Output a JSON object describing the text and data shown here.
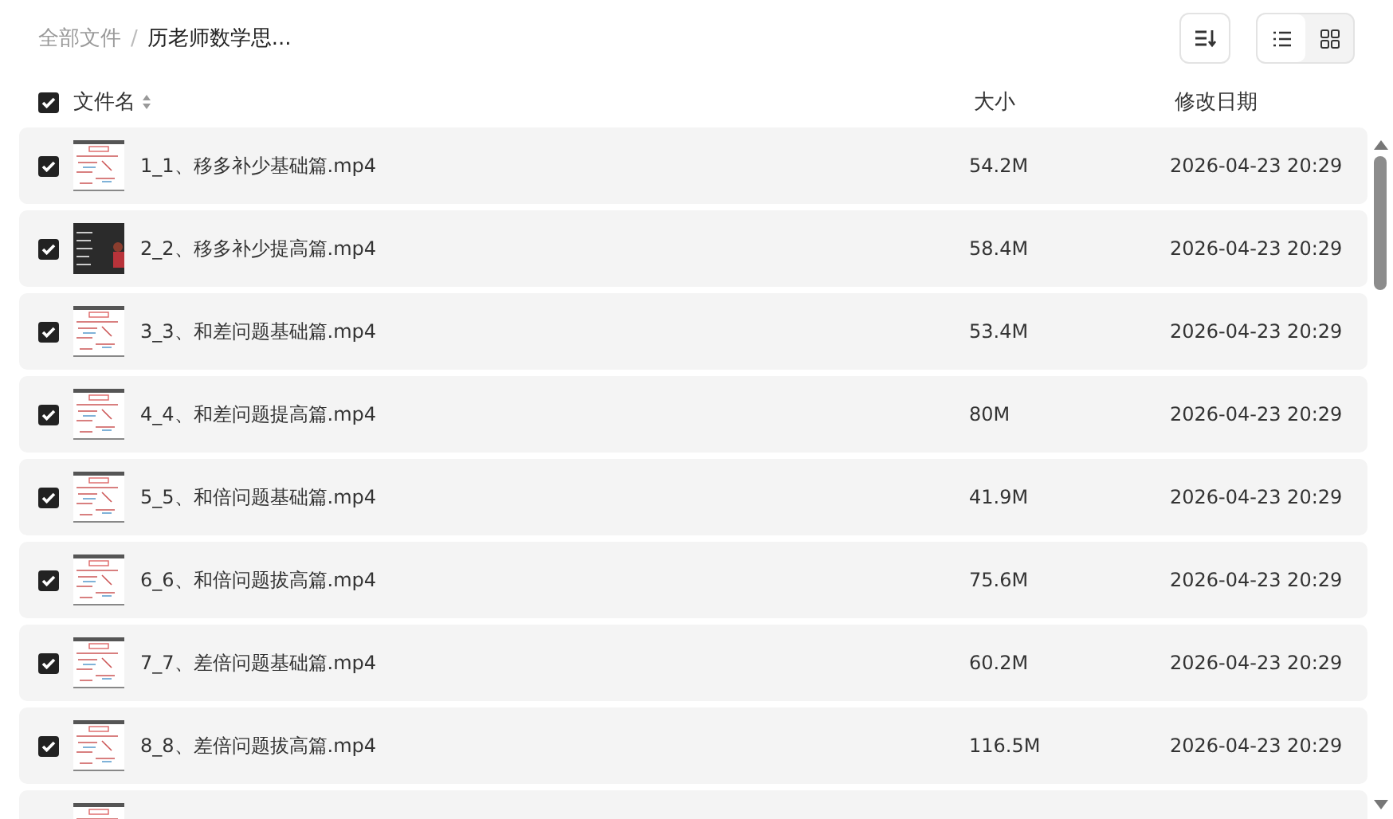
{
  "breadcrumb": [
    {
      "label": "全部文件",
      "current": false
    },
    {
      "label": "历老师数学思...",
      "current": true
    }
  ],
  "breadcrumb_separator": "/",
  "view_modes": [
    {
      "kind": "list",
      "selected": true
    },
    {
      "kind": "grid",
      "selected": false
    }
  ],
  "header": {
    "checked": true,
    "columns": [
      "文件名",
      "大小",
      "修改日期"
    ]
  },
  "rows": [
    {
      "checked": true,
      "kind": "document",
      "name": "1_1、移多补少基础篇.mp4",
      "size": "54.2M",
      "date": "2026-04-23 20:29"
    },
    {
      "checked": true,
      "kind": "dark",
      "name": "2_2、移多补少提高篇.mp4",
      "size": "58.4M",
      "date": "2026-04-23 20:29"
    },
    {
      "checked": true,
      "kind": "document",
      "name": "3_3、和差问题基础篇.mp4",
      "size": "53.4M",
      "date": "2026-04-23 20:29"
    },
    {
      "checked": true,
      "kind": "document",
      "name": "4_4、和差问题提高篇.mp4",
      "size": "80M",
      "date": "2026-04-23 20:29"
    },
    {
      "checked": true,
      "kind": "document",
      "name": "5_5、和倍问题基础篇.mp4",
      "size": "41.9M",
      "date": "2026-04-23 20:29"
    },
    {
      "checked": true,
      "kind": "document",
      "name": "6_6、和倍问题拔高篇.mp4",
      "size": "75.6M",
      "date": "2026-04-23 20:29"
    },
    {
      "checked": true,
      "kind": "document",
      "name": "7_7、差倍问题基础篇.mp4",
      "size": "60.2M",
      "date": "2026-04-23 20:29"
    },
    {
      "checked": true,
      "kind": "document",
      "name": "8_8、差倍问题拔高篇.mp4",
      "size": "116.5M",
      "date": "2026-04-23 20:29"
    },
    {
      "kind": "document"
    }
  ]
}
